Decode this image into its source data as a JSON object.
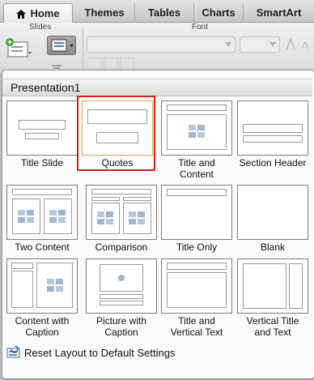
{
  "tabs": [
    {
      "label": "Home",
      "active": true
    },
    {
      "label": "Themes"
    },
    {
      "label": "Tables"
    },
    {
      "label": "Charts"
    },
    {
      "label": "SmartArt"
    }
  ],
  "ribbon": {
    "slides_label": "Slides",
    "font_label": "Font"
  },
  "panel": {
    "title": "Presentation1",
    "selected_layout": "Quotes",
    "layouts": [
      {
        "name": "Title Slide"
      },
      {
        "name": "Quotes"
      },
      {
        "name": "Title and\nContent"
      },
      {
        "name": "Section Header"
      },
      {
        "name": "Two Content"
      },
      {
        "name": "Comparison"
      },
      {
        "name": "Title Only"
      },
      {
        "name": "Blank"
      },
      {
        "name": "Content with\nCaption"
      },
      {
        "name": "Picture with\nCaption"
      },
      {
        "name": "Title and\nVertical Text"
      },
      {
        "name": "Vertical Title\nand Text"
      }
    ],
    "reset_label": "Reset Layout to Default Settings"
  },
  "colors": {
    "selection_outline": "#d21d1d",
    "selected_thumb_border": "#e7a25a"
  }
}
